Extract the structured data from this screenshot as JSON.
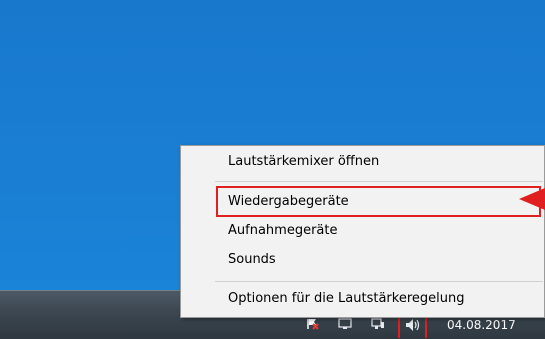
{
  "context_menu": {
    "items": [
      {
        "label": "Lautstärkemixer öffnen"
      },
      {
        "label": "Wiedergabegeräte"
      },
      {
        "label": "Aufnahmegeräte"
      },
      {
        "label": "Sounds"
      },
      {
        "label": "Optionen für die Lautstärkeregelung"
      }
    ],
    "highlighted_item": "Wiedergabegeräte"
  },
  "taskbar": {
    "tray_icons": [
      "action-center-flag-icon",
      "monitor-icon",
      "network-icon",
      "volume-icon"
    ],
    "date": "04.08.2017"
  },
  "annotation": {
    "highlight_color": "#e02020"
  },
  "colors": {
    "desktop": "#1a7fd3",
    "menu_background": "#f2f2f2"
  }
}
